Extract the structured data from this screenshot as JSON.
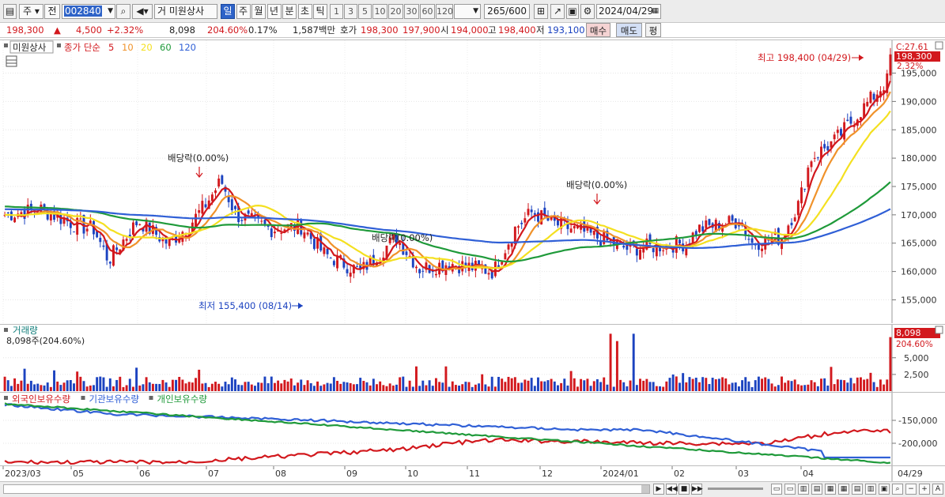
{
  "toolbar": {
    "type1": "주",
    "type2": "전",
    "code": "002840",
    "name_prefix": "거",
    "name": "미원상사",
    "period_tabs": [
      "일",
      "주",
      "월",
      "년",
      "분",
      "초",
      "틱"
    ],
    "active_period": "일",
    "intervals": [
      "1",
      "3",
      "5",
      "10",
      "20",
      "30",
      "60",
      "120"
    ],
    "count": "265",
    "count_total": "/600",
    "date": "2024/04/29"
  },
  "quote": {
    "price": "198,300",
    "arrow": "▲",
    "change": "4,500",
    "change_pct": "+2.32%",
    "volume": "8,098",
    "volume_ratio": "204.60%",
    "turnover_pct": "0.17%",
    "amount": "1,587백만",
    "hoga_label": "호가",
    "ask": "198,300",
    "bid": "197,900",
    "open_label": "시",
    "open": "194,000",
    "high_label": "고",
    "high": "198,400",
    "low_label": "저",
    "low": "193,100",
    "buy": "매수",
    "sell": "매도",
    "eval": "평"
  },
  "price_pane": {
    "stock_label": "미원상사",
    "ma_label": "종가 단순",
    "ma_periods": [
      "5",
      "10",
      "20",
      "60",
      "120"
    ],
    "ma_colors": [
      "#d2181d",
      "#f0922a",
      "#f4e020",
      "#1f9a3a",
      "#2f5fd6"
    ],
    "y_ticks": [
      "195,000",
      "190,000",
      "185,000",
      "180,000",
      "175,000",
      "170,000",
      "165,000",
      "160,000",
      "155,000"
    ],
    "tag_c": "C:27.61",
    "tag_price": "198,300",
    "tag_pct": "2.32%",
    "high_note": "최고 198,400 (04/29)",
    "low_note": "최저 155,400 (08/14)",
    "div1": "배당락(0.00%)",
    "div2": "배당락(0.00%)",
    "div3": "배당락(0.00%)"
  },
  "volume_pane": {
    "title": "거래량",
    "value": "8,098주(204.60%)",
    "y_ticks": [
      "5,000",
      "2,500"
    ],
    "tag_value": "8,098",
    "tag_pct": "204.60%"
  },
  "holding_pane": {
    "series": [
      "외국인보유수량",
      "기관보유수량",
      "개인보유수량"
    ],
    "colors": [
      "#d2181d",
      "#2f5fd6",
      "#1f9a3a"
    ],
    "y_ticks": [
      "-150,000",
      "-200,000"
    ]
  },
  "x_axis": {
    "labels": [
      "2023/03",
      "05",
      "06",
      "07",
      "08",
      "09",
      "10",
      "11",
      "12",
      "2024/01",
      "02",
      "03",
      "04"
    ],
    "right_label": "04/29"
  }
}
